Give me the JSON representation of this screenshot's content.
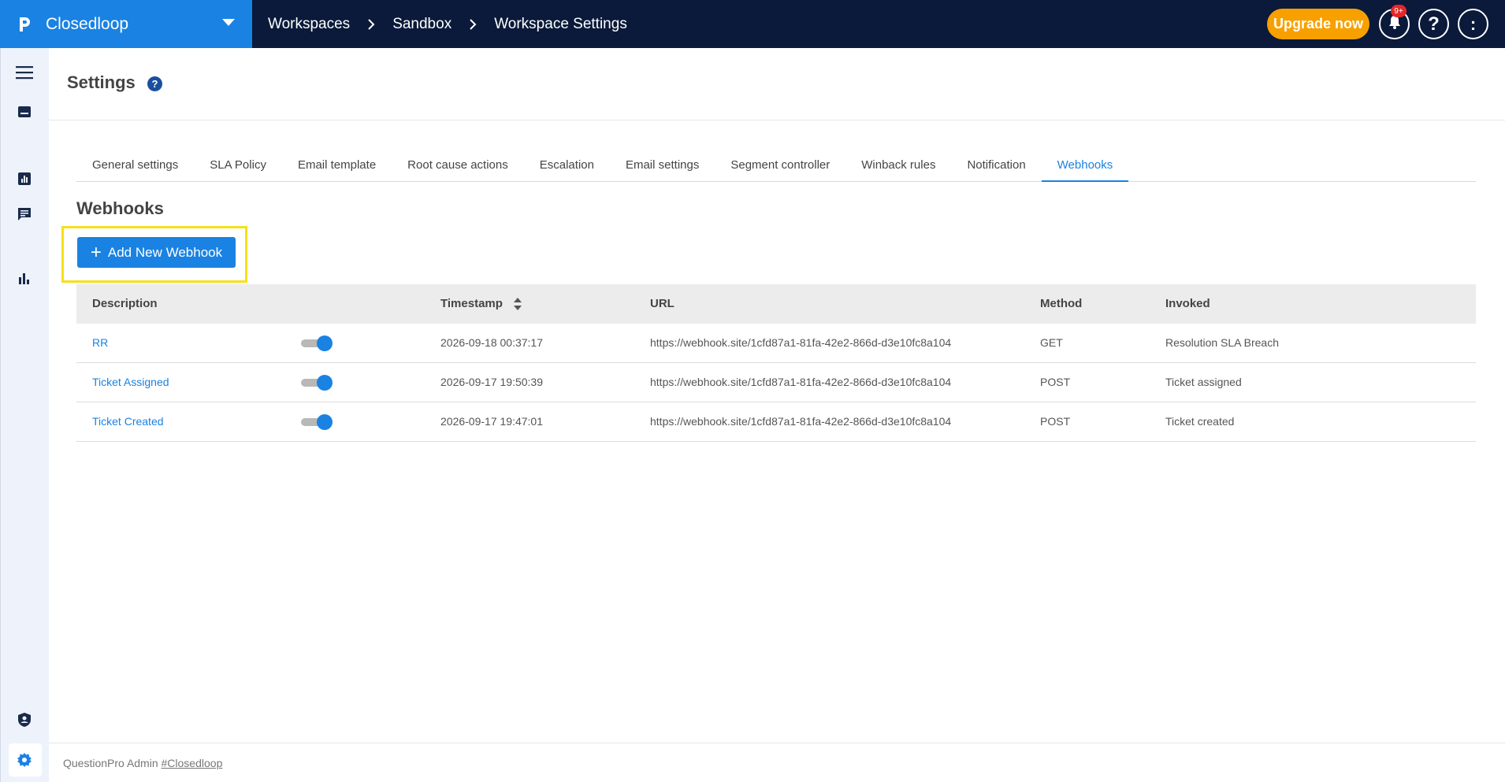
{
  "header": {
    "app_name": "Closedloop",
    "breadcrumbs": [
      "Workspaces",
      "Sandbox",
      "Workspace Settings"
    ],
    "upgrade_label": "Upgrade now",
    "notification_badge": "9+",
    "help_label": "?",
    "avatar_label": ":"
  },
  "sidebar": {
    "items": [
      "menu-icon",
      "inbox-icon",
      "report-icon",
      "chat-icon",
      "analytics-icon",
      "shield-user-icon",
      "gear-icon"
    ]
  },
  "page": {
    "title": "Settings",
    "help_label": "?"
  },
  "tabs": [
    {
      "label": "General settings",
      "active": false
    },
    {
      "label": "SLA Policy",
      "active": false
    },
    {
      "label": "Email template",
      "active": false
    },
    {
      "label": "Root cause actions",
      "active": false
    },
    {
      "label": "Escalation",
      "active": false
    },
    {
      "label": "Email settings",
      "active": false
    },
    {
      "label": "Segment controller",
      "active": false
    },
    {
      "label": "Winback rules",
      "active": false
    },
    {
      "label": "Notification",
      "active": false
    },
    {
      "label": "Webhooks",
      "active": true
    }
  ],
  "webhooks": {
    "title": "Webhooks",
    "add_button_label": "Add New Webhook",
    "columns": [
      "Description",
      "Timestamp",
      "URL",
      "Method",
      "Invoked"
    ],
    "rows": [
      {
        "description": "RR",
        "enabled": true,
        "timestamp": "2026-09-18 00:37:17",
        "url": "https://webhook.site/1cfd87a1-81fa-42e2-866d-d3e10fc8a104",
        "method": "GET",
        "invoked": "Resolution SLA Breach"
      },
      {
        "description": "Ticket Assigned",
        "enabled": true,
        "timestamp": "2026-09-17 19:50:39",
        "url": "https://webhook.site/1cfd87a1-81fa-42e2-866d-d3e10fc8a104",
        "method": "POST",
        "invoked": "Ticket assigned"
      },
      {
        "description": "Ticket Created",
        "enabled": true,
        "timestamp": "2026-09-17 19:47:01",
        "url": "https://webhook.site/1cfd87a1-81fa-42e2-866d-d3e10fc8a104",
        "method": "POST",
        "invoked": "Ticket created"
      }
    ]
  },
  "footer": {
    "text": "QuestionPro Admin",
    "link": "#Closedloop"
  },
  "colors": {
    "brand": "#1a82e2",
    "topbar": "#0b1a3a",
    "upgrade": "#f8a000",
    "highlight": "#f6e01a"
  }
}
